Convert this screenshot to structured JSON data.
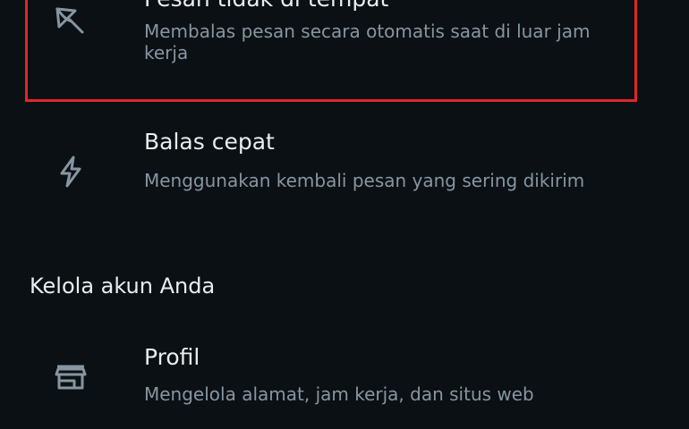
{
  "items": [
    {
      "title": "Pesan tidak di tempat",
      "description": "Membalas pesan secara otomatis saat di luar jam kerja",
      "icon": "umbrella-icon"
    },
    {
      "title": "Balas cepat",
      "description": "Menggunakan kembali pesan yang sering dikirim",
      "icon": "lightning-icon"
    },
    {
      "title": "Profil",
      "description": "Mengelola alamat, jam kerja, dan situs web",
      "icon": "store-icon"
    }
  ],
  "section": {
    "title": "Kelola akun Anda"
  },
  "colors": {
    "background": "#0b1014",
    "primary_text": "#e9edef",
    "secondary_text": "#8696a0",
    "icon": "#8696a0",
    "highlight": "#e0262b"
  }
}
